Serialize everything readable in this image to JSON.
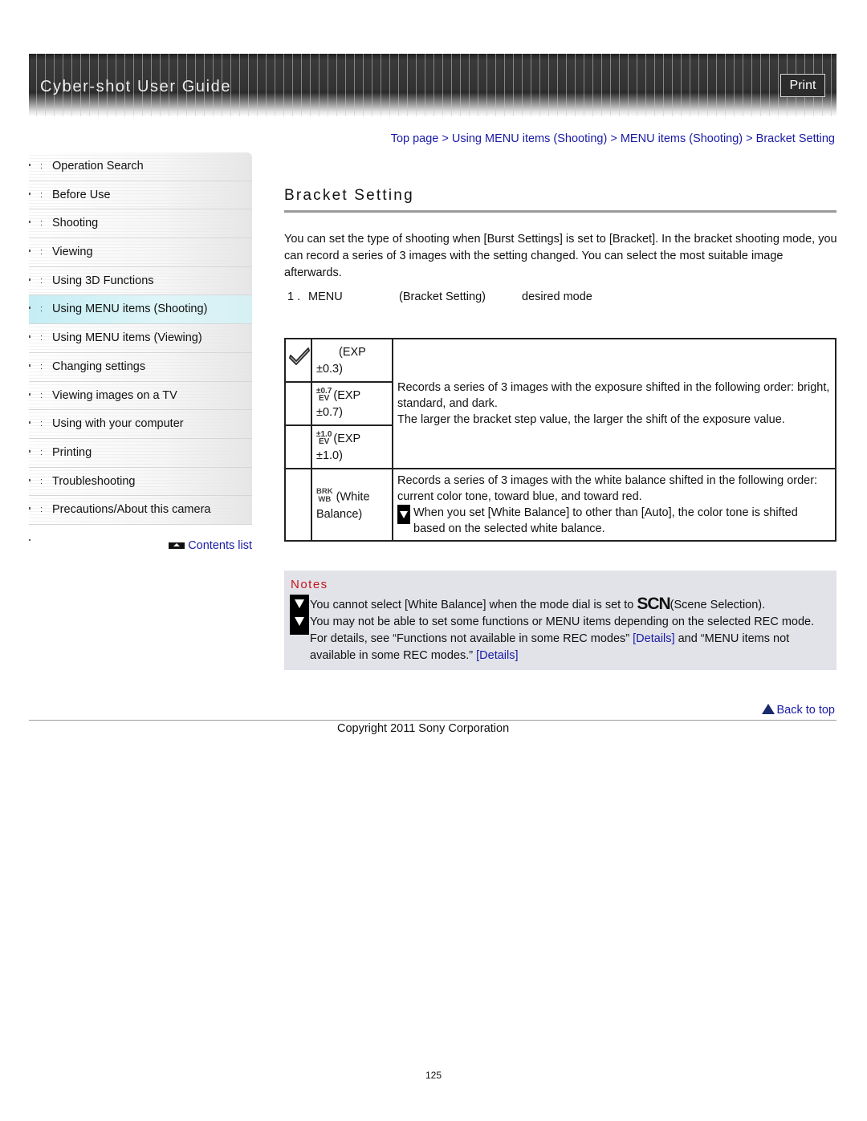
{
  "header": {
    "title": "Cyber-shot User Guide",
    "print_label": "Print"
  },
  "breadcrumb": [
    {
      "label": "Top page"
    },
    {
      "label": "Using MENU items (Shooting)"
    },
    {
      "label": "MENU items (Shooting)"
    },
    {
      "label": "Bracket Setting"
    }
  ],
  "breadcrumb_separator": ">",
  "sidebar": {
    "items": [
      {
        "label": "Operation Search",
        "active": false
      },
      {
        "label": "Before Use",
        "active": false
      },
      {
        "label": "Shooting",
        "active": false
      },
      {
        "label": "Viewing",
        "active": false
      },
      {
        "label": "Using 3D Functions",
        "active": false
      },
      {
        "label": "Using MENU items (Shooting)",
        "active": true
      },
      {
        "label": "Using MENU items (Viewing)",
        "active": false
      },
      {
        "label": "Changing settings",
        "active": false
      },
      {
        "label": "Viewing images on a TV",
        "active": false
      },
      {
        "label": "Using with your computer",
        "active": false
      },
      {
        "label": "Printing",
        "active": false
      },
      {
        "label": "Troubleshooting",
        "active": false
      },
      {
        "label": "Precautions/About this camera",
        "active": false
      }
    ],
    "bullet": ":",
    "contents_list_label": "Contents list"
  },
  "main": {
    "title": "Bracket Setting",
    "intro": "You can set the type of shooting when [Burst Settings] is set to [Bracket]. In the bracket shooting mode, you can record a series of 3 images with the setting changed. You can select the most suitable image afterwards.",
    "step": {
      "number": "1 .",
      "menu": "MENU",
      "setting": "(Bracket Setting)",
      "target": "desired mode"
    },
    "modes": [
      {
        "icon": "check-icon",
        "icon_text": "",
        "label": "(EXP ±0.3)",
        "selected": true
      },
      {
        "icon": "ev-0.7-icon",
        "icon_text": "±0.7 EV",
        "label": "(EXP ±0.7)",
        "selected": false
      },
      {
        "icon": "ev-1.0-icon",
        "icon_text": "±1.0 EV",
        "label": "(EXP ±1.0)",
        "selected": false
      },
      {
        "icon": "brk-wb-icon",
        "icon_text": "BRK WB",
        "label": "(White Balance)",
        "selected": false
      }
    ],
    "exp_description": {
      "line1": "Records a series of 3 images with the exposure shifted in the following order: bright, standard, and dark.",
      "line2": "The larger the bracket step value, the larger the shift of the exposure value."
    },
    "wb_description": {
      "text": "Records a series of 3 images with the white balance shifted in the following order: current color tone, toward blue, and toward red.",
      "note": "When you set [White Balance] to other than [Auto], the color tone is shifted based on the selected white balance."
    }
  },
  "notes": {
    "title": "Notes",
    "note1_before": "You cannot select [White Balance] when the mode dial is set to ",
    "note1_icon_text": "SCN",
    "note1_after": "(Scene Selection).",
    "note2_part1": "You may not be able to set some functions or MENU items depending on the selected REC mode. For details, see “Functions not available in some REC modes” ",
    "note2_link1": "[Details]",
    "note2_part2": " and “MENU items not available in some REC modes.” ",
    "note2_link2": "[Details]"
  },
  "footer": {
    "back_to_top": "Back to top",
    "copyright": "Copyright 2011 Sony Corporation",
    "page_number": "125"
  },
  "colors": {
    "link": "#1a1aa6",
    "notes_title": "#c4151c",
    "notes_bg": "#e2e3e8",
    "active_nav": "#c4eef4"
  }
}
